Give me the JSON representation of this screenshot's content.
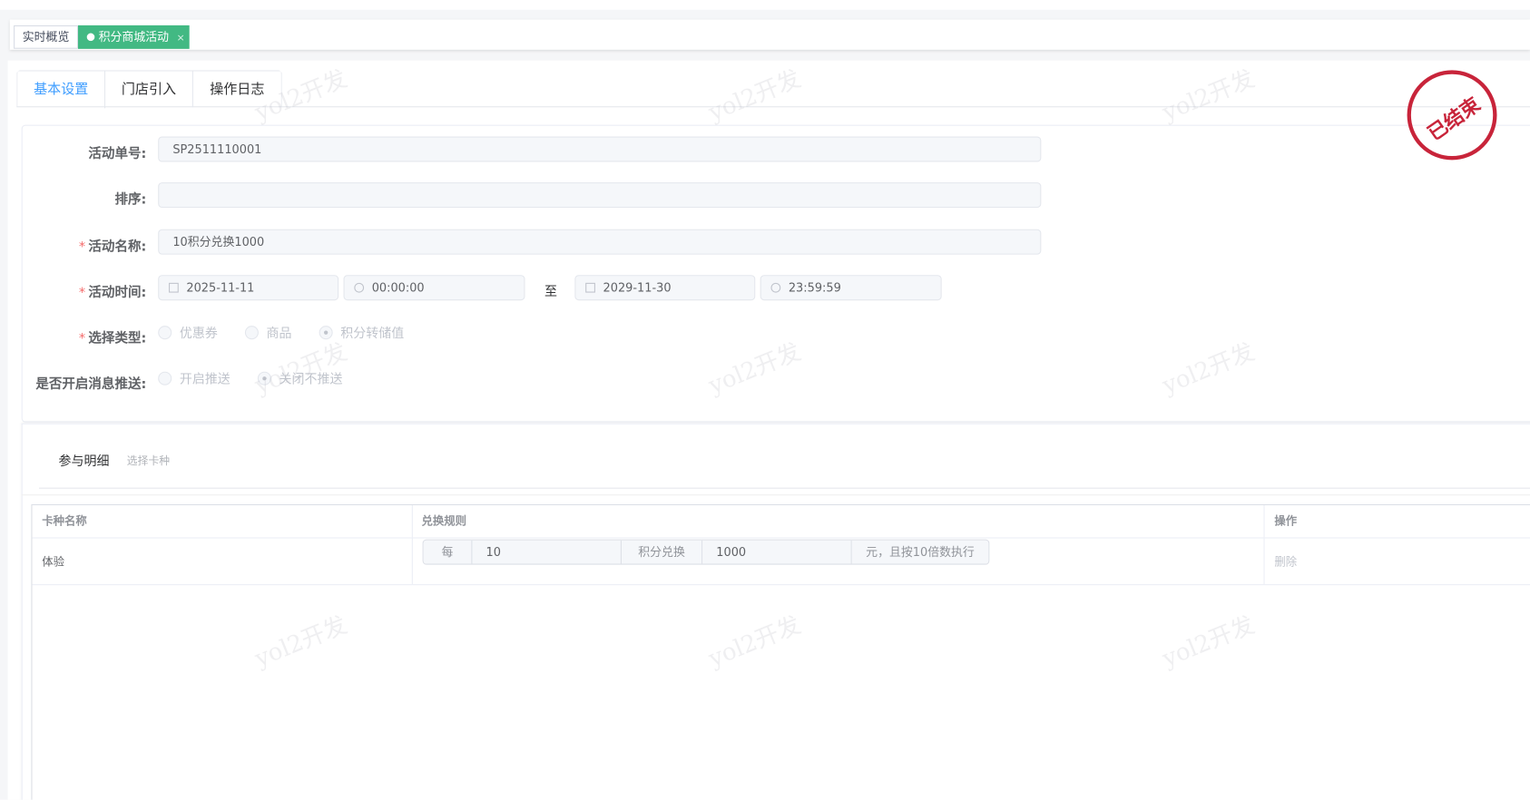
{
  "tags": [
    {
      "label": "实时概览",
      "active": false
    },
    {
      "label": "积分商城活动",
      "active": true,
      "close": "×"
    }
  ],
  "tabs": [
    "基本设置",
    "门店引入",
    "操作日志"
  ],
  "form": {
    "code_label": "活动单号:",
    "code_value": "SP2511110001",
    "sort_label": "排序:",
    "sort_value": "",
    "name_label": "活动名称:",
    "name_value": "10积分兑换1000",
    "time_label": "活动时间:",
    "start_date": "2025-11-11",
    "start_time": "00:00:00",
    "to": "至",
    "end_date": "2029-11-30",
    "end_time": "23:59:59",
    "type_label": "选择类型:",
    "type_options": [
      "优惠券",
      "商品",
      "积分转储值"
    ],
    "type_selected": "积分转储值",
    "push_label": "是否开启消息推送:",
    "push_options": [
      "开启推送",
      "关闭不推送"
    ],
    "push_selected": "关闭不推送",
    "required_mark": "*"
  },
  "detail": {
    "title": "参与明细",
    "select_link": "选择卡种"
  },
  "table": {
    "headers": [
      "卡种名称",
      "兑换规则",
      "操作"
    ],
    "rows": [
      {
        "card": "体验",
        "per": "每",
        "points": "10",
        "mid": "积分兑换",
        "amount": "1000",
        "suffix": "元，且按10倍数执行",
        "action": "删除"
      }
    ]
  },
  "stamp": "已结束",
  "watermark": "yol2开发",
  "colors": {
    "accent": "#409eff",
    "tag_active": "#42b983",
    "stamp": "#c8243a",
    "required": "#f56c6c"
  }
}
